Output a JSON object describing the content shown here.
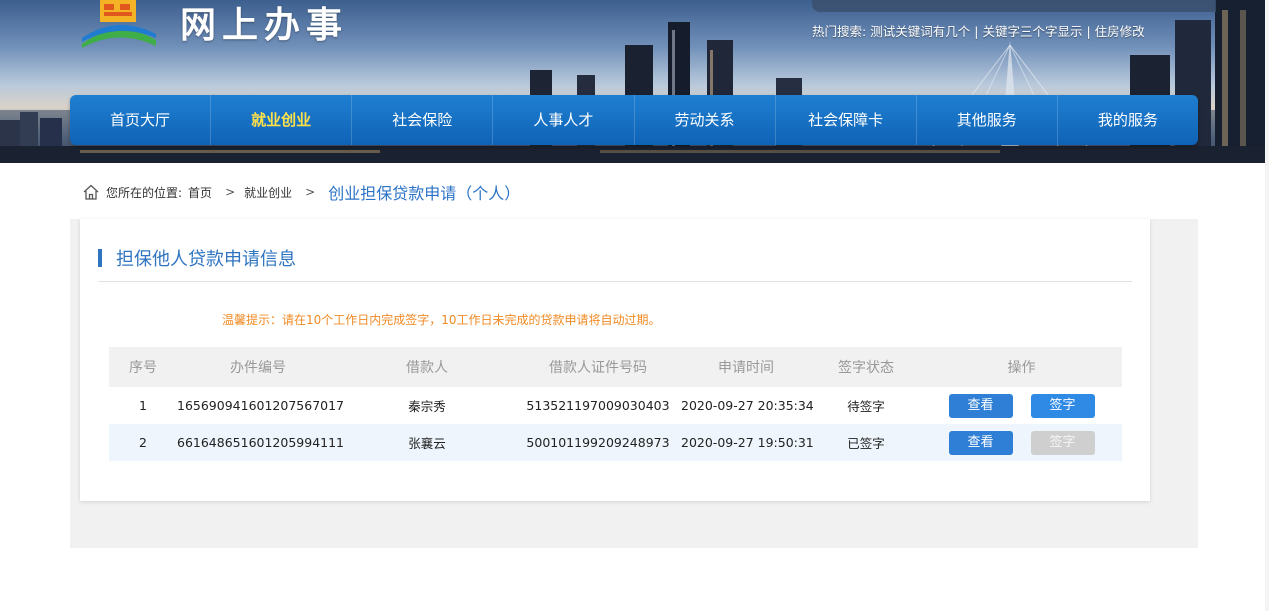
{
  "header": {
    "site_title": "网上办事",
    "logo_icon": "government-building-logo-icon",
    "hot_search": {
      "label": "热门搜索:",
      "items": [
        "测试关键词有几个",
        "关键字三个字显示",
        "住房修改"
      ],
      "separator": "|"
    }
  },
  "nav": {
    "items": [
      {
        "label": "首页大厅",
        "active": false
      },
      {
        "label": "就业创业",
        "active": true
      },
      {
        "label": "社会保险",
        "active": false
      },
      {
        "label": "人事人才",
        "active": false
      },
      {
        "label": "劳动关系",
        "active": false
      },
      {
        "label": "社会保障卡",
        "active": false
      },
      {
        "label": "其他服务",
        "active": false
      },
      {
        "label": "我的服务",
        "active": false
      }
    ]
  },
  "breadcrumb": {
    "home_icon": "home-icon",
    "prefix": "您所在的位置:",
    "items": [
      "首页",
      "就业创业"
    ],
    "current": "创业担保贷款申请（个人）",
    "separator": ">"
  },
  "section": {
    "title": "担保他人贷款申请信息",
    "tip": "温馨提示：请在10个工作日内完成签字，10工作日未完成的贷款申请将自动过期。"
  },
  "table": {
    "headers": [
      "序号",
      "办件编号",
      "借款人",
      "借款人证件号码",
      "申请时间",
      "签字状态",
      "操作"
    ],
    "rows": [
      {
        "no": "1",
        "case_id": "165690941601207567017",
        "borrower": "秦宗秀",
        "id_number": "513521197009030403",
        "apply_time": "2020-09-27 20:35:34",
        "status": "待签字",
        "view_label": "查看",
        "sign_label": "签字",
        "sign_enabled": true
      },
      {
        "no": "2",
        "case_id": "661648651601205994111",
        "borrower": "张襄云",
        "id_number": "500101199209248973",
        "apply_time": "2020-09-27 19:50:31",
        "status": "已签字",
        "view_label": "查看",
        "sign_label": "签字",
        "sign_enabled": false
      }
    ]
  },
  "colors": {
    "nav_bg": "#1473c8",
    "nav_active": "#ffe24a",
    "accent_blue": "#2f74c0",
    "tip_orange": "#f08a24",
    "button_blue": "#2f7fd6",
    "button_disabled": "#cfcfcf"
  }
}
